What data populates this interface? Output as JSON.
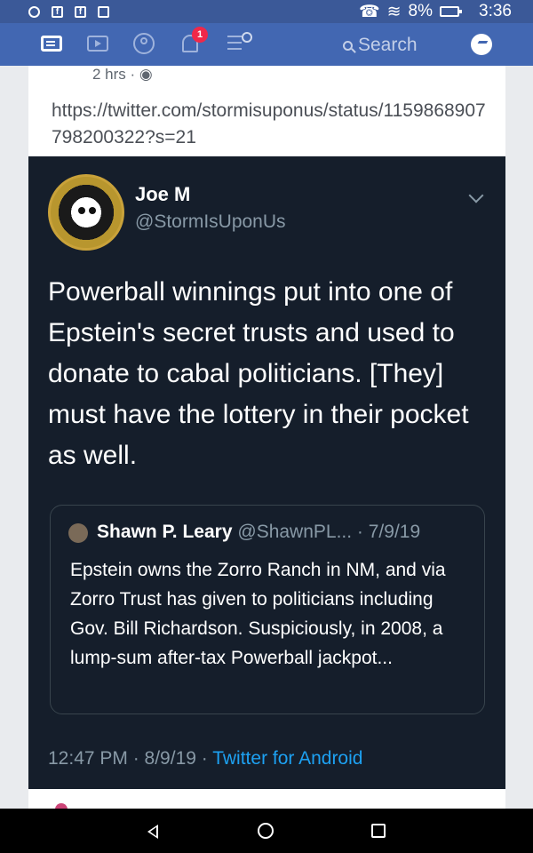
{
  "status_bar": {
    "battery": "8%",
    "time": "3:36"
  },
  "nav": {
    "notification_count": "1",
    "search_label": "Search"
  },
  "post": {
    "timestamp": "2 hrs · ",
    "link_text": "https://twitter.com/stormisuponus/status/1159868907798200322?s=21"
  },
  "tweet": {
    "author_name": "Joe M",
    "author_handle": "@StormIsUponUs",
    "text": "Powerball winnings put into one of Epstein's secret trusts and used to donate to cabal politicians. [They] must have the lottery in their pocket as well.",
    "quoted": {
      "author_name": "Shawn P. Leary",
      "handle_date": "@ShawnPL... · 7/9/19",
      "text": "Epstein owns the Zorro Ranch in NM, and via Zorro Trust has given to politicians including Gov. Bill Richardson. Suspiciously, in 2008, a lump-sum after-tax Powerball jackpot..."
    },
    "footer_time": "12:47 PM · 8/9/19 · ",
    "footer_source": "Twitter for Android"
  },
  "colors": {
    "fb_blue": "#4267b2",
    "tweet_bg": "#151e2b",
    "twitter_link": "#1da1f2"
  }
}
